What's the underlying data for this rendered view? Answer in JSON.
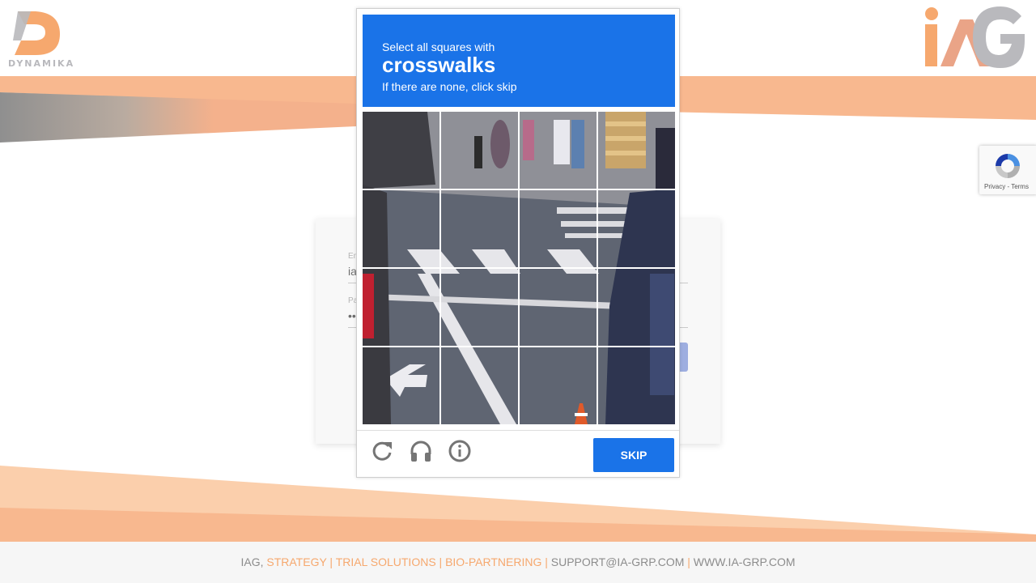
{
  "brand": {
    "left_logo_text": "DYNAMIKA",
    "right_logo_text": "IAG",
    "accent": "#f6a86e",
    "gray": "#b9b9bd"
  },
  "login": {
    "email_label": "Em",
    "email_value": "ia",
    "password_label": "Pa",
    "password_value": "••"
  },
  "recaptcha_badge": {
    "links": "Privacy - Terms"
  },
  "captcha": {
    "prompt_line1": "Select all squares with",
    "prompt_target": "crosswalks",
    "prompt_line3": "If there are none, click skip",
    "skip_label": "SKIP",
    "header_color": "#1a73e8",
    "icons": [
      "reload-icon",
      "headphones-icon",
      "info-icon"
    ],
    "grid_rows": 4,
    "grid_cols": 4
  },
  "footer": {
    "company": "IAG, ",
    "services": "STRATEGY | TRIAL SOLUTIONS | BIO-PARTNERING | ",
    "email": "SUPPORT@IA-GRP.COM",
    "separator": " | ",
    "website": "WWW.IA-GRP.COM"
  }
}
